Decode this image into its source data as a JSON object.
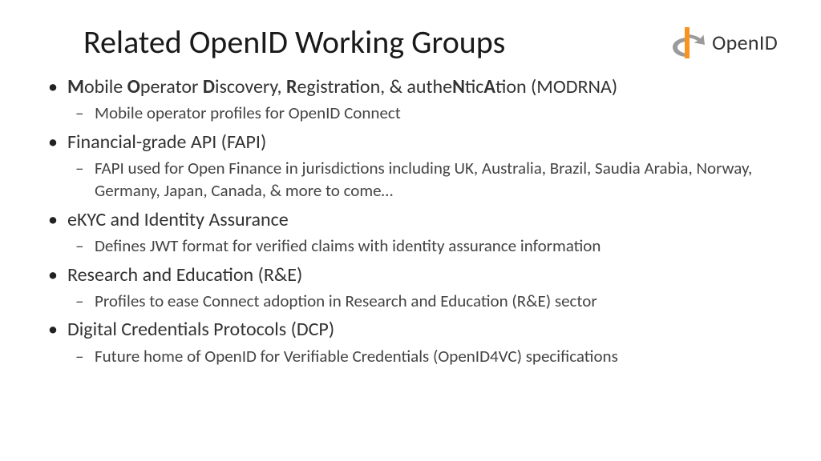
{
  "title": "Related OpenID Working Groups",
  "logo": {
    "text": "OpenID",
    "icon_name": "openid-icon",
    "accent": "#f7931e",
    "gray": "#9b9b9b"
  },
  "items": [
    {
      "heading_html": "<b>M</b>obile <b>O</b>perator <b>D</b>iscovery, <b>R</b>egistration, &amp; authe<b>N</b>tic<b>A</b>tion (MODRNA)",
      "sub": [
        "Mobile operator profiles for OpenID Connect"
      ]
    },
    {
      "heading_html": "Financial-grade API (FAPI)",
      "sub": [
        "FAPI used for Open Finance in jurisdictions including UK, Australia, Brazil, Saudia Arabia, Norway, Germany, Japan, Canada, &amp; more to come…"
      ]
    },
    {
      "heading_html": "eKYC and Identity Assurance",
      "sub": [
        "Defines JWT format for verified claims with identity assurance information"
      ]
    },
    {
      "heading_html": "Research and Education (R&amp;E)",
      "sub": [
        "Profiles to ease Connect adoption in Research and Education (R&amp;E) sector"
      ]
    },
    {
      "heading_html": "Digital Credentials Protocols (DCP)",
      "sub": [
        "Future home of OpenID for Verifiable Credentials (OpenID4VC) specifications"
      ]
    }
  ]
}
